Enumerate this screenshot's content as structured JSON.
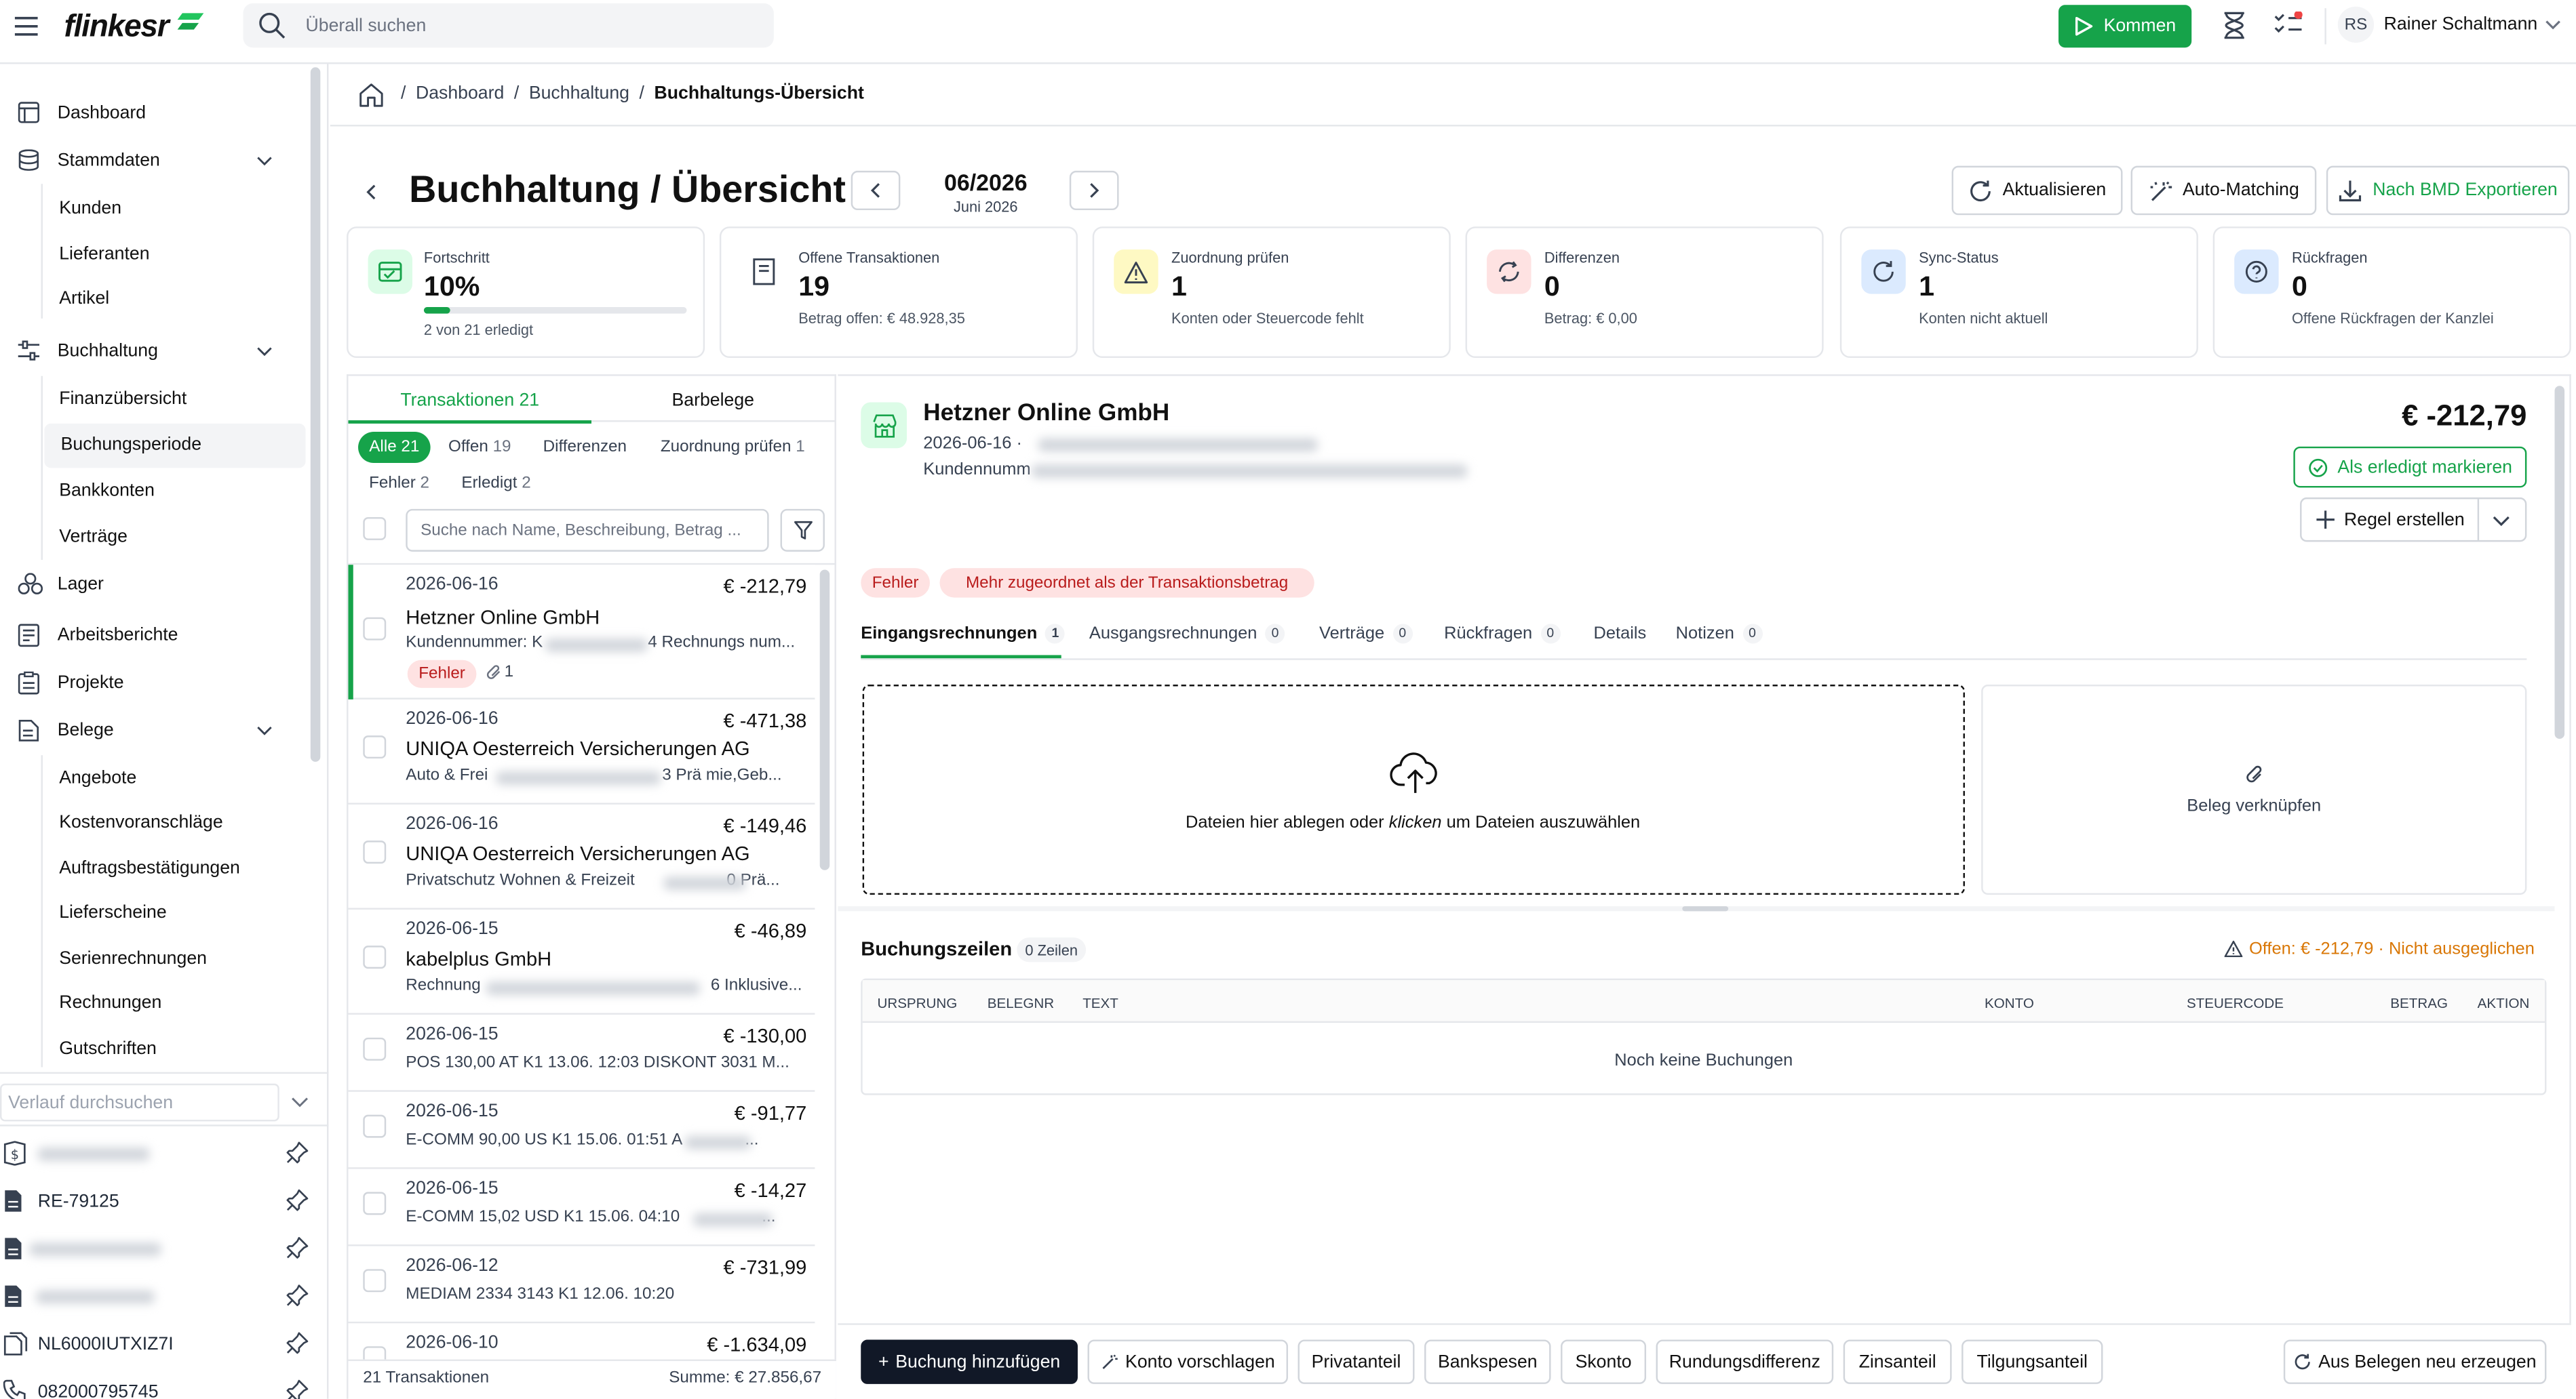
{
  "header": {
    "logo_text": "flinkesr",
    "search_placeholder": "Überall suchen",
    "kommen_label": "Kommen",
    "user_initials": "RS",
    "user_name": "Rainer Schaltmann"
  },
  "sidebar": {
    "items": [
      {
        "label": "Dashboard",
        "icon": "dashboard-icon"
      },
      {
        "label": "Stammdaten",
        "icon": "database-icon"
      },
      {
        "label": "Kunden"
      },
      {
        "label": "Lieferanten"
      },
      {
        "label": "Artikel"
      },
      {
        "label": "Buchhaltung",
        "icon": "sliders-icon"
      },
      {
        "label": "Finanzübersicht"
      },
      {
        "label": "Buchungsperiode"
      },
      {
        "label": "Bankkonten"
      },
      {
        "label": "Verträge"
      },
      {
        "label": "Lager",
        "icon": "boxes-icon"
      },
      {
        "label": "Arbeitsberichte",
        "icon": "report-icon"
      },
      {
        "label": "Projekte",
        "icon": "clipboard-icon"
      },
      {
        "label": "Belege",
        "icon": "document-icon"
      },
      {
        "label": "Angebote"
      },
      {
        "label": "Kostenvoranschläge"
      },
      {
        "label": "Auftragsbestätigungen"
      },
      {
        "label": "Lieferscheine"
      },
      {
        "label": "Serienrechnungen"
      },
      {
        "label": "Rechnungen"
      },
      {
        "label": "Gutschriften"
      }
    ],
    "history_placeholder": "Verlauf durchsuchen",
    "history": [
      "",
      "RE-79125",
      "",
      "",
      "NL6000IUTXIZ7I",
      "082000795745"
    ]
  },
  "breadcrumb": {
    "items": [
      "Dashboard",
      "Buchhaltung",
      "Buchhaltungs-Übersicht"
    ]
  },
  "page": {
    "title": "Buchhaltung / Übersicht",
    "period": "06/2026",
    "period_sub": "Juni 2026",
    "actions": [
      "Aktualisieren",
      "Auto-Matching",
      "Nach BMD Exportieren"
    ]
  },
  "stats": [
    {
      "label": "Fortschritt",
      "value": "10%",
      "sub": "2 von 21 erledigt",
      "progress": 0.1
    },
    {
      "label": "Offene Transaktionen",
      "value": "19",
      "sub": "Betrag offen: € 48.928,35"
    },
    {
      "label": "Zuordnung prüfen",
      "value": "1",
      "sub": "Konten oder Steuercode fehlt"
    },
    {
      "label": "Differenzen",
      "value": "0",
      "sub": "Betrag: € 0,00"
    },
    {
      "label": "Sync-Status",
      "value": "1",
      "sub": "Konten nicht aktuell"
    },
    {
      "label": "Rückfragen",
      "value": "0",
      "sub": "Offene Rückfragen der Kanzlei"
    }
  ],
  "list_tabs": {
    "transaktionen": "Transaktionen",
    "transaktionen_count": "21",
    "barbelege": "Barbelege"
  },
  "filters": [
    {
      "label": "Alle",
      "count": "21"
    },
    {
      "label": "Offen",
      "count": "19"
    },
    {
      "label": "Differenzen",
      "count": ""
    },
    {
      "label": "Zuordnung prüfen",
      "count": "1"
    },
    {
      "label": "Fehler",
      "count": "2"
    },
    {
      "label": "Erledigt",
      "count": "2"
    }
  ],
  "list_search_placeholder": "Suche nach Name, Beschreibung, Betrag ...",
  "transactions": [
    {
      "date": "2026-06-16",
      "amount": "€ -212,79",
      "name": "Hetzner Online GmbH",
      "desc": "Kundennummer: K",
      "desc2": "4 Rechnungs num...",
      "tag": "Fehler",
      "att": "1"
    },
    {
      "date": "2026-06-16",
      "amount": "€ -471,38",
      "name": "UNIQA Oesterreich Versicherungen AG",
      "desc": "Auto & Frei",
      "desc2": "3 Prä mie,Geb..."
    },
    {
      "date": "2026-06-16",
      "amount": "€ -149,46",
      "name": "UNIQA Oesterreich Versicherungen AG",
      "desc": "Privatschutz Wohnen & Freizeit",
      "desc2": "0 Prä..."
    },
    {
      "date": "2026-06-15",
      "amount": "€ -46,89",
      "name": "kabelplus GmbH",
      "desc": "Rechnung",
      "desc2": "6 Inklusive..."
    },
    {
      "date": "2026-06-15",
      "amount": "€ -130,00",
      "name": "",
      "desc": "POS 130,00 AT K1 13.06. 12:03 DISKONT 3031 M...",
      "desc2": ""
    },
    {
      "date": "2026-06-15",
      "amount": "€ -91,77",
      "name": "",
      "desc": "E-COMM 90,00 US K1 15.06. 01:51 A",
      "desc2": "..."
    },
    {
      "date": "2026-06-15",
      "amount": "€ -14,27",
      "name": "",
      "desc": "E-COMM 15,02 USD K1 15.06. 04:10",
      "desc2": "..."
    },
    {
      "date": "2026-06-12",
      "amount": "€ -731,99",
      "name": "",
      "desc": "MEDIAM 2334 3143 K1 12.06. 10:20",
      "desc2": ""
    },
    {
      "date": "2026-06-10",
      "amount": "€ -1.634,09",
      "name": "",
      "desc": "",
      "desc2": ""
    }
  ],
  "list_footer": {
    "count": "21 Transaktionen",
    "sum": "Summe: € 27.856,67"
  },
  "detail": {
    "name": "Hetzner Online GmbH",
    "date": "2026-06-16 ·",
    "line2": "Kundennumm",
    "amount": "€ -212,79",
    "mark_done": "Als erledigt markieren",
    "rule": "Regel erstellen",
    "tag_error": "Fehler",
    "tag_msg": "Mehr zugeordnet als der Transaktionsbetrag",
    "tabs": [
      {
        "label": "Eingangsrechnungen",
        "count": "1"
      },
      {
        "label": "Ausgangsrechnungen",
        "count": "0"
      },
      {
        "label": "Verträge",
        "count": "0"
      },
      {
        "label": "Rückfragen",
        "count": "0"
      },
      {
        "label": "Details",
        "count": ""
      },
      {
        "label": "Notizen",
        "count": "0"
      }
    ],
    "drop_text_a": "Dateien hier ablegen oder ",
    "drop_text_b": "klicken",
    "drop_text_c": " um Dateien auszuwählen",
    "link_text": "Beleg verknüpfen",
    "lines_title": "Buchungszeilen",
    "lines_count": "0 Zeilen",
    "open_warn": "Offen: € -212,79 · Nicht ausgeglichen",
    "columns": [
      "URSPRUNG",
      "BELEGNR",
      "TEXT",
      "KONTO",
      "STEUERCODE",
      "BETRAG",
      "AKTION"
    ],
    "empty": "Noch keine Buchungen"
  },
  "bottom_buttons": [
    "Buchung hinzufügen",
    "Konto vorschlagen",
    "Privatanteil",
    "Bankspesen",
    "Skonto",
    "Rundungsdifferenz",
    "Zinsanteil",
    "Tilgungsanteil"
  ],
  "regen": "Aus Belegen neu erzeugen"
}
